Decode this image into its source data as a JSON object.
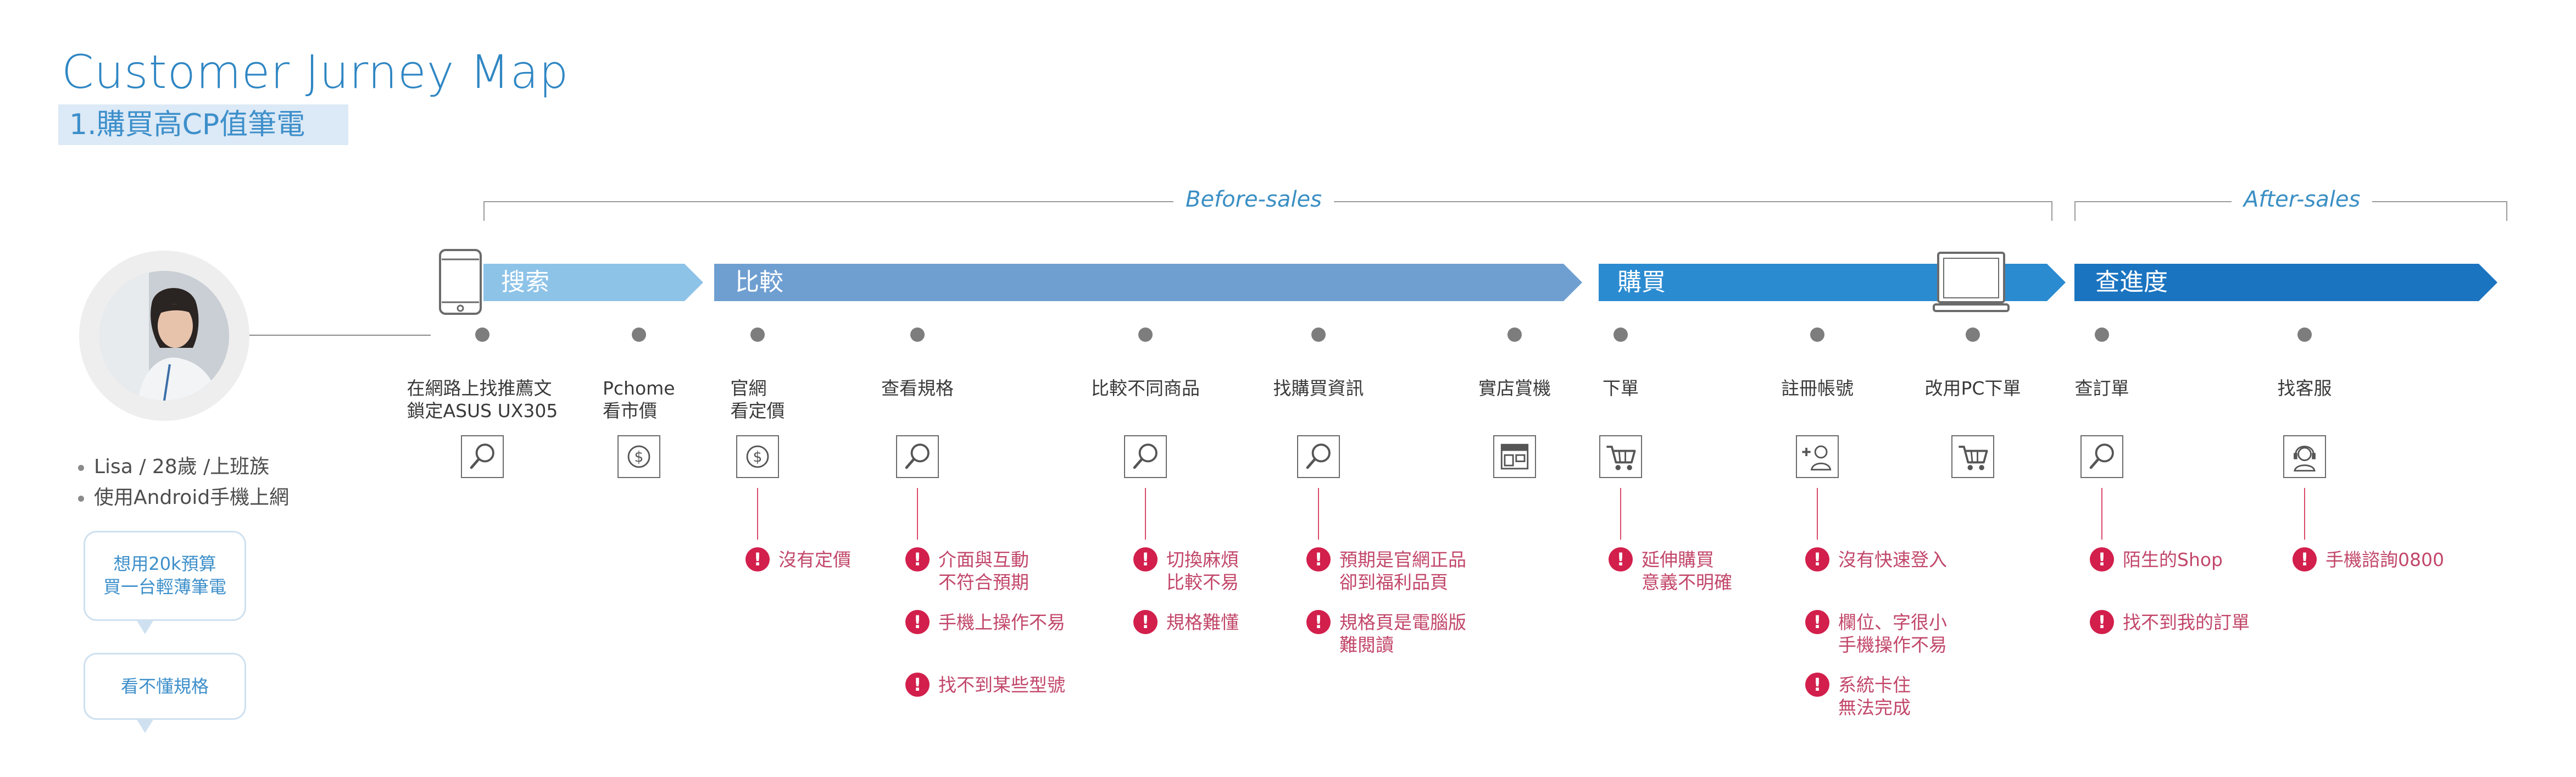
{
  "title": "Customer Jurney Map",
  "subtitle": "1.購買高CP值筆電",
  "phases": [
    {
      "label": "Before-sales"
    },
    {
      "label": "After-sales"
    }
  ],
  "stages": [
    {
      "label": "搜索",
      "color": "#8ec3e8"
    },
    {
      "label": "比較",
      "color": "#6f9fd1"
    },
    {
      "label": "購買",
      "color": "#2b8bd0"
    },
    {
      "label": "查進度",
      "color": "#1b74c0"
    }
  ],
  "persona": {
    "items": [
      "Lisa / 28歲 /上班族",
      "使用Android手機上網"
    ],
    "bubbles": [
      {
        "lines": [
          "想用20k預算",
          "買一台輕薄筆電"
        ]
      },
      {
        "lines": [
          "看不懂規格"
        ]
      }
    ]
  },
  "steps": [
    {
      "lines": [
        "在網路上找推薦文",
        "鎖定ASUS UX305"
      ],
      "icon": "search-icon",
      "pains": []
    },
    {
      "lines": [
        "Pchome",
        "看市價"
      ],
      "icon": "dollar-icon",
      "pains": []
    },
    {
      "lines": [
        "官網",
        "看定價"
      ],
      "icon": "dollar-icon",
      "pains": [
        {
          "lines": [
            "沒有定價"
          ]
        }
      ]
    },
    {
      "lines": [
        "查看規格"
      ],
      "icon": "search-icon",
      "pains": [
        {
          "lines": [
            "介面與互動",
            "不符合預期"
          ]
        },
        {
          "lines": [
            "手機上操作不易"
          ]
        },
        {
          "lines": [
            "找不到某些型號"
          ]
        }
      ]
    },
    {
      "lines": [
        "比較不同商品"
      ],
      "icon": "search-icon",
      "pains": [
        {
          "lines": [
            "切換麻煩",
            "比較不易"
          ]
        },
        {
          "lines": [
            "規格難懂"
          ]
        }
      ]
    },
    {
      "lines": [
        "找購買資訊"
      ],
      "icon": "search-icon",
      "pains": [
        {
          "lines": [
            "預期是官網正品",
            "卻到福利品頁"
          ]
        },
        {
          "lines": [
            "規格頁是電腦版",
            "難閱讀"
          ]
        }
      ]
    },
    {
      "lines": [
        "實店賞機"
      ],
      "icon": "store-icon",
      "pains": []
    },
    {
      "lines": [
        "下單"
      ],
      "icon": "cart-icon",
      "pains": [
        {
          "lines": [
            "延伸購買",
            "意義不明確"
          ]
        }
      ]
    },
    {
      "lines": [
        "註冊帳號"
      ],
      "icon": "add-user-icon",
      "pains": [
        {
          "lines": [
            "沒有快速登入"
          ]
        },
        {
          "lines": [
            "欄位、字很小",
            "手機操作不易"
          ]
        },
        {
          "lines": [
            "系統卡住",
            "無法完成"
          ]
        }
      ]
    },
    {
      "lines": [
        "改用PC下單"
      ],
      "icon": "cart-icon",
      "pains": []
    },
    {
      "lines": [
        "查訂單"
      ],
      "icon": "search-icon",
      "pains": [
        {
          "lines": [
            "陌生的Shop"
          ]
        },
        {
          "lines": [
            "找不到我的訂單"
          ]
        }
      ]
    },
    {
      "lines": [
        "找客服"
      ],
      "icon": "support-icon",
      "pains": [
        {
          "lines": [
            "手機諮詢0800"
          ]
        }
      ]
    }
  ]
}
